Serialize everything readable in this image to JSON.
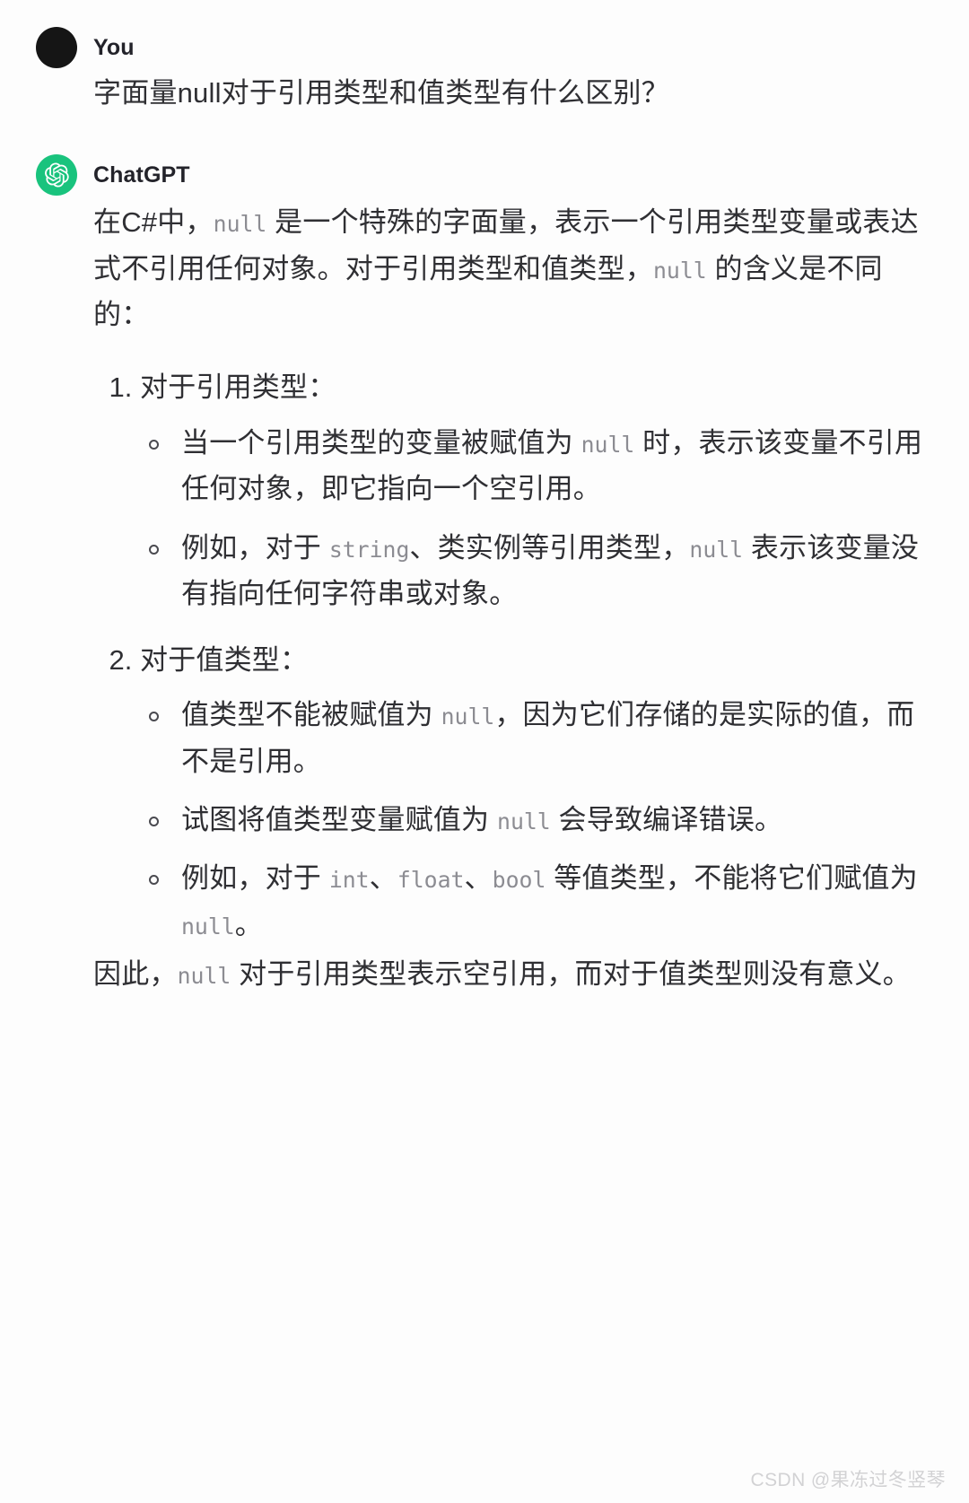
{
  "page": {
    "background_color": "#fdfdfd",
    "text_color": "#2f2f33",
    "code_color": "#8c8c92",
    "accent_color": "#19c37d"
  },
  "messages": {
    "user": {
      "author": "You",
      "avatar_icon": "user-avatar-dot",
      "avatar_color": "#151515",
      "question": "字面量null对于引用类型和值类型有什么区别？"
    },
    "assistant": {
      "author": "ChatGPT",
      "avatar_icon": "openai-logo-icon",
      "avatar_color": "#19c37d",
      "intro": {
        "s1": "在C#中，",
        "c1": "null",
        "s2": " 是一个特殊的字面量，表示一个引用类型变量或表达式不引用任何对象。对于引用类型和值类型，",
        "c2": "null",
        "s3": " 的含义是不同的："
      },
      "list": [
        {
          "title": "对于引用类型：",
          "bullets": [
            {
              "s1": "当一个引用类型的变量被赋值为 ",
              "c1": "null",
              "s2": " 时，表示该变量不引用任何对象，即它指向一个空引用。"
            },
            {
              "s1": "例如，对于 ",
              "c1": "string",
              "s2": "、类实例等引用类型，",
              "c2": "null",
              "s3": " 表示该变量没有指向任何字符串或对象。"
            }
          ]
        },
        {
          "title": "对于值类型：",
          "bullets": [
            {
              "s1": "值类型不能被赋值为 ",
              "c1": "null",
              "s2": "，因为它们存储的是实际的值，而不是引用。"
            },
            {
              "s1": "试图将值类型变量赋值为 ",
              "c1": "null",
              "s2": " 会导致编译错误。"
            },
            {
              "s1": "例如，对于 ",
              "c1": "int",
              "s2": "、",
              "c2": "float",
              "s3": "、",
              "c3": "bool",
              "s4": " 等值类型，不能将它们赋值为 ",
              "c4": "null",
              "s5": "。"
            }
          ]
        }
      ],
      "conclusion": {
        "s1": "因此，",
        "c1": "null",
        "s2": " 对于引用类型表示空引用，而对于值类型则没有意义。"
      }
    }
  },
  "watermark": {
    "text": "CSDN @果冻过冬竖琴"
  }
}
